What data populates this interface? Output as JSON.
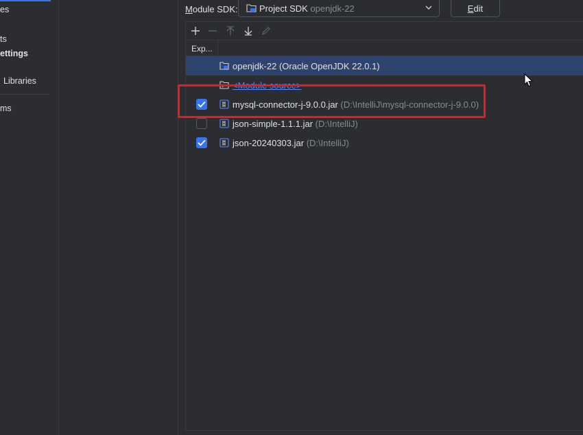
{
  "nav": {
    "items": [
      {
        "label": "es"
      },
      {
        "label": "ts"
      },
      {
        "label": "ettings"
      },
      {
        "label": "Libraries"
      },
      {
        "label": "ms"
      }
    ]
  },
  "sdk": {
    "label_underlined": "M",
    "label_rest": "odule SDK:",
    "value": "Project SDK",
    "value_sub": "openjdk-22",
    "edit_underlined": "E",
    "edit_rest": "dit"
  },
  "toolbar": {
    "icons": [
      "add-icon",
      "remove-icon",
      "move-up-icon",
      "move-down-icon",
      "edit-icon"
    ]
  },
  "table": {
    "export_header": "Exp...",
    "rows": [
      {
        "checkbox": null,
        "icon": "sdk-folder-icon",
        "text": "openjdk-22",
        "sub": "(Oracle OpenJDK 22.0.1)",
        "selected": true
      },
      {
        "checkbox": null,
        "icon": "folder-icon",
        "text": "<Module source>",
        "sub": "",
        "selected": false
      },
      {
        "checkbox": true,
        "icon": "jar-icon",
        "text": "mysql-connector-j-9.0.0.jar",
        "sub": "(D:\\IntelliJ\\mysql-connector-j-9.0.0)",
        "selected": false
      },
      {
        "checkbox": false,
        "icon": "jar-icon",
        "text": "json-simple-1.1.1.jar",
        "sub": "(D:\\IntelliJ)",
        "selected": false
      },
      {
        "checkbox": true,
        "icon": "jar-icon",
        "text": "json-20240303.jar",
        "sub": "(D:\\IntelliJ)",
        "selected": false
      }
    ]
  },
  "colors": {
    "background": "#2b2d30",
    "selection": "#2e436e",
    "accent": "#3574f0",
    "highlight": "#e81c1c",
    "link": "#548af7",
    "muted": "#868a91"
  }
}
